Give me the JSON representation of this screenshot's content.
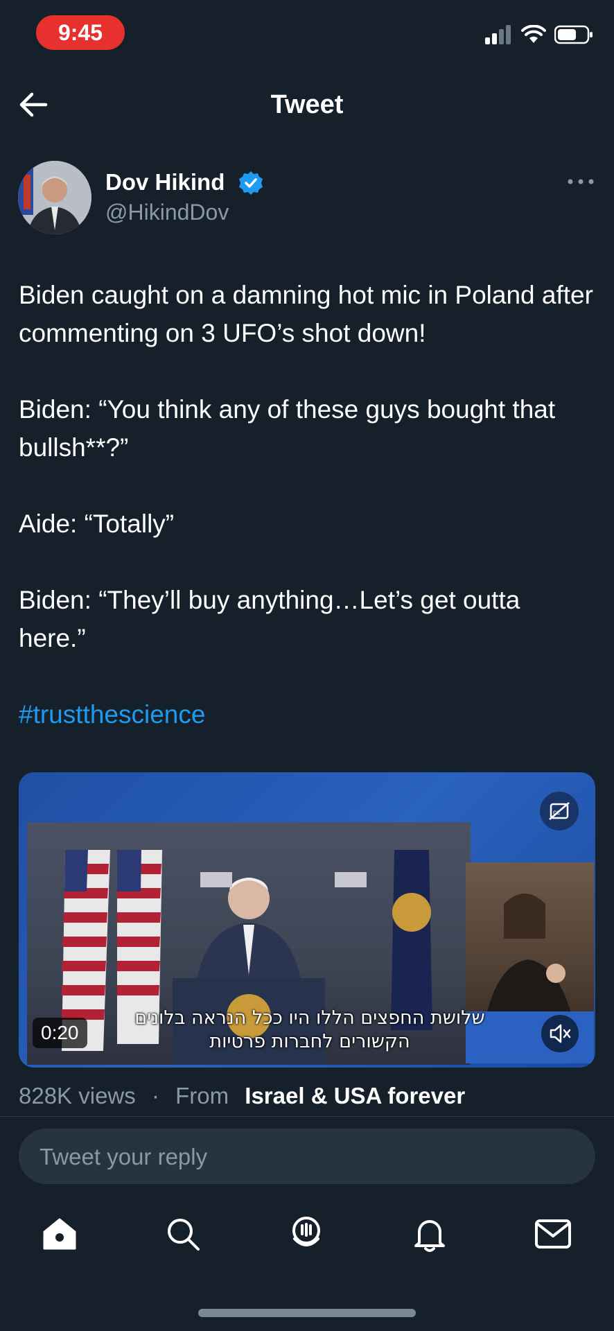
{
  "status_bar": {
    "time": "9:45"
  },
  "nav": {
    "title": "Tweet"
  },
  "author": {
    "name": "Dov Hikind",
    "handle": "@HikindDov"
  },
  "tweet": {
    "lines": [
      "Biden caught on a damning hot mic in Poland after commenting on 3 UFO’s shot down!",
      "Biden: “You think any of these guys bought that bullsh**?”",
      "Aide: “Totally”",
      "Biden: “They’ll buy anything…Let’s get outta here.”"
    ],
    "hashtag": "#trustthescience"
  },
  "media": {
    "duration": "0:20",
    "subtitle_line1": "שלושת החפצים הללו היו ככל הנראה בלונים",
    "subtitle_line2": "הקשורים לחברות פרטיות"
  },
  "meta": {
    "views": "828K views",
    "separator": "·",
    "from_label": "From",
    "source": "Israel & USA forever"
  },
  "reply": {
    "placeholder": "Tweet your reply"
  },
  "colors": {
    "background": "#15202b",
    "accent": "#1d9bf0",
    "muted": "#8b98a5",
    "status_pill": "#e7312f"
  }
}
